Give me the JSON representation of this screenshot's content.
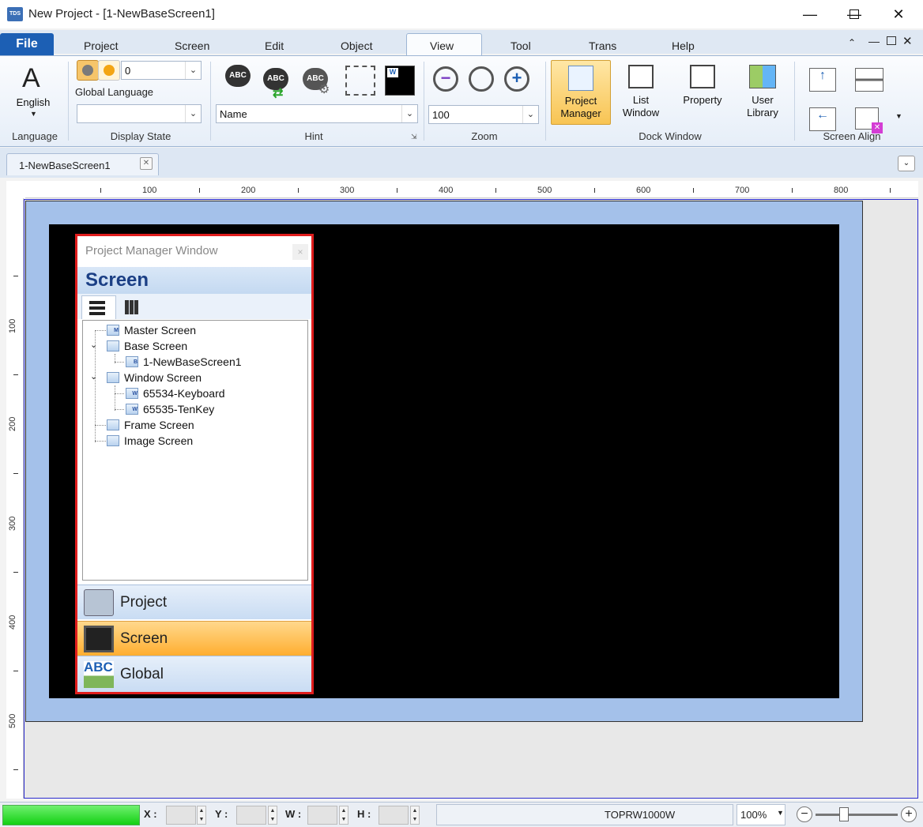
{
  "window": {
    "title": "New Project - [1-NewBaseScreen1]",
    "logo_text": "TDS",
    "minimize": "—",
    "maximize": "☐",
    "close": "✕"
  },
  "ribbon": {
    "file_tab": "File",
    "tabs": [
      "Project",
      "Screen",
      "Edit",
      "Object",
      "View",
      "Tool",
      "Trans",
      "Help"
    ],
    "active_tab": "View",
    "language_group": {
      "icon_letter": "A",
      "label": "English",
      "group_label": "Language"
    },
    "display_state_group": {
      "state_value": "0",
      "global_language": "Global Language",
      "display_value": "",
      "group_label": "Display State"
    },
    "hint_group": {
      "hint_value": "Name",
      "group_label": "Hint",
      "abc": "ABC"
    },
    "zoom_group": {
      "zoom_value": "100",
      "group_label": "Zoom"
    },
    "dock_window_group": {
      "group_label": "Dock Window",
      "buttons": [
        {
          "line1": "Project",
          "line2": "Manager"
        },
        {
          "line1": "List",
          "line2": "Window"
        },
        {
          "line1": "Property",
          "line2": ""
        },
        {
          "line1": "User",
          "line2": "Library"
        }
      ]
    },
    "screen_align_group": {
      "group_label": "Screen Align"
    }
  },
  "document_tab": {
    "label": "1-NewBaseScreen1"
  },
  "ruler": {
    "horizontal": [
      "100",
      "200",
      "300",
      "400",
      "500",
      "600",
      "700",
      "800"
    ],
    "vertical": [
      "100",
      "200",
      "300",
      "400",
      "500"
    ]
  },
  "project_manager": {
    "title": "Project Manager Window",
    "close": "×",
    "header": "Screen",
    "tree": [
      {
        "label": "Master Screen",
        "badge": "M"
      },
      {
        "label": "Base Screen",
        "badge": ""
      },
      {
        "label": "1-NewBaseScreen1",
        "badge": "B"
      },
      {
        "label": "Window Screen",
        "badge": ""
      },
      {
        "label": "65534-Keyboard",
        "badge": "W"
      },
      {
        "label": "65535-TenKey",
        "badge": "W"
      },
      {
        "label": "Frame Screen",
        "badge": ""
      },
      {
        "label": "Image Screen",
        "badge": ""
      }
    ],
    "nav": [
      {
        "label": "Project"
      },
      {
        "label": "Screen"
      },
      {
        "label": "Global",
        "icon_text": "ABC"
      }
    ]
  },
  "status_bar": {
    "x_label": "X :",
    "y_label": "Y :",
    "w_label": "W :",
    "h_label": "H :",
    "device": "TOPRW1000W",
    "zoom": "100%",
    "zoom_slider_fraction": 0.35
  },
  "colors": {
    "accent": "#1c5fb4",
    "active_nav": "#ffc040",
    "selection_border": "#e01d1d"
  }
}
